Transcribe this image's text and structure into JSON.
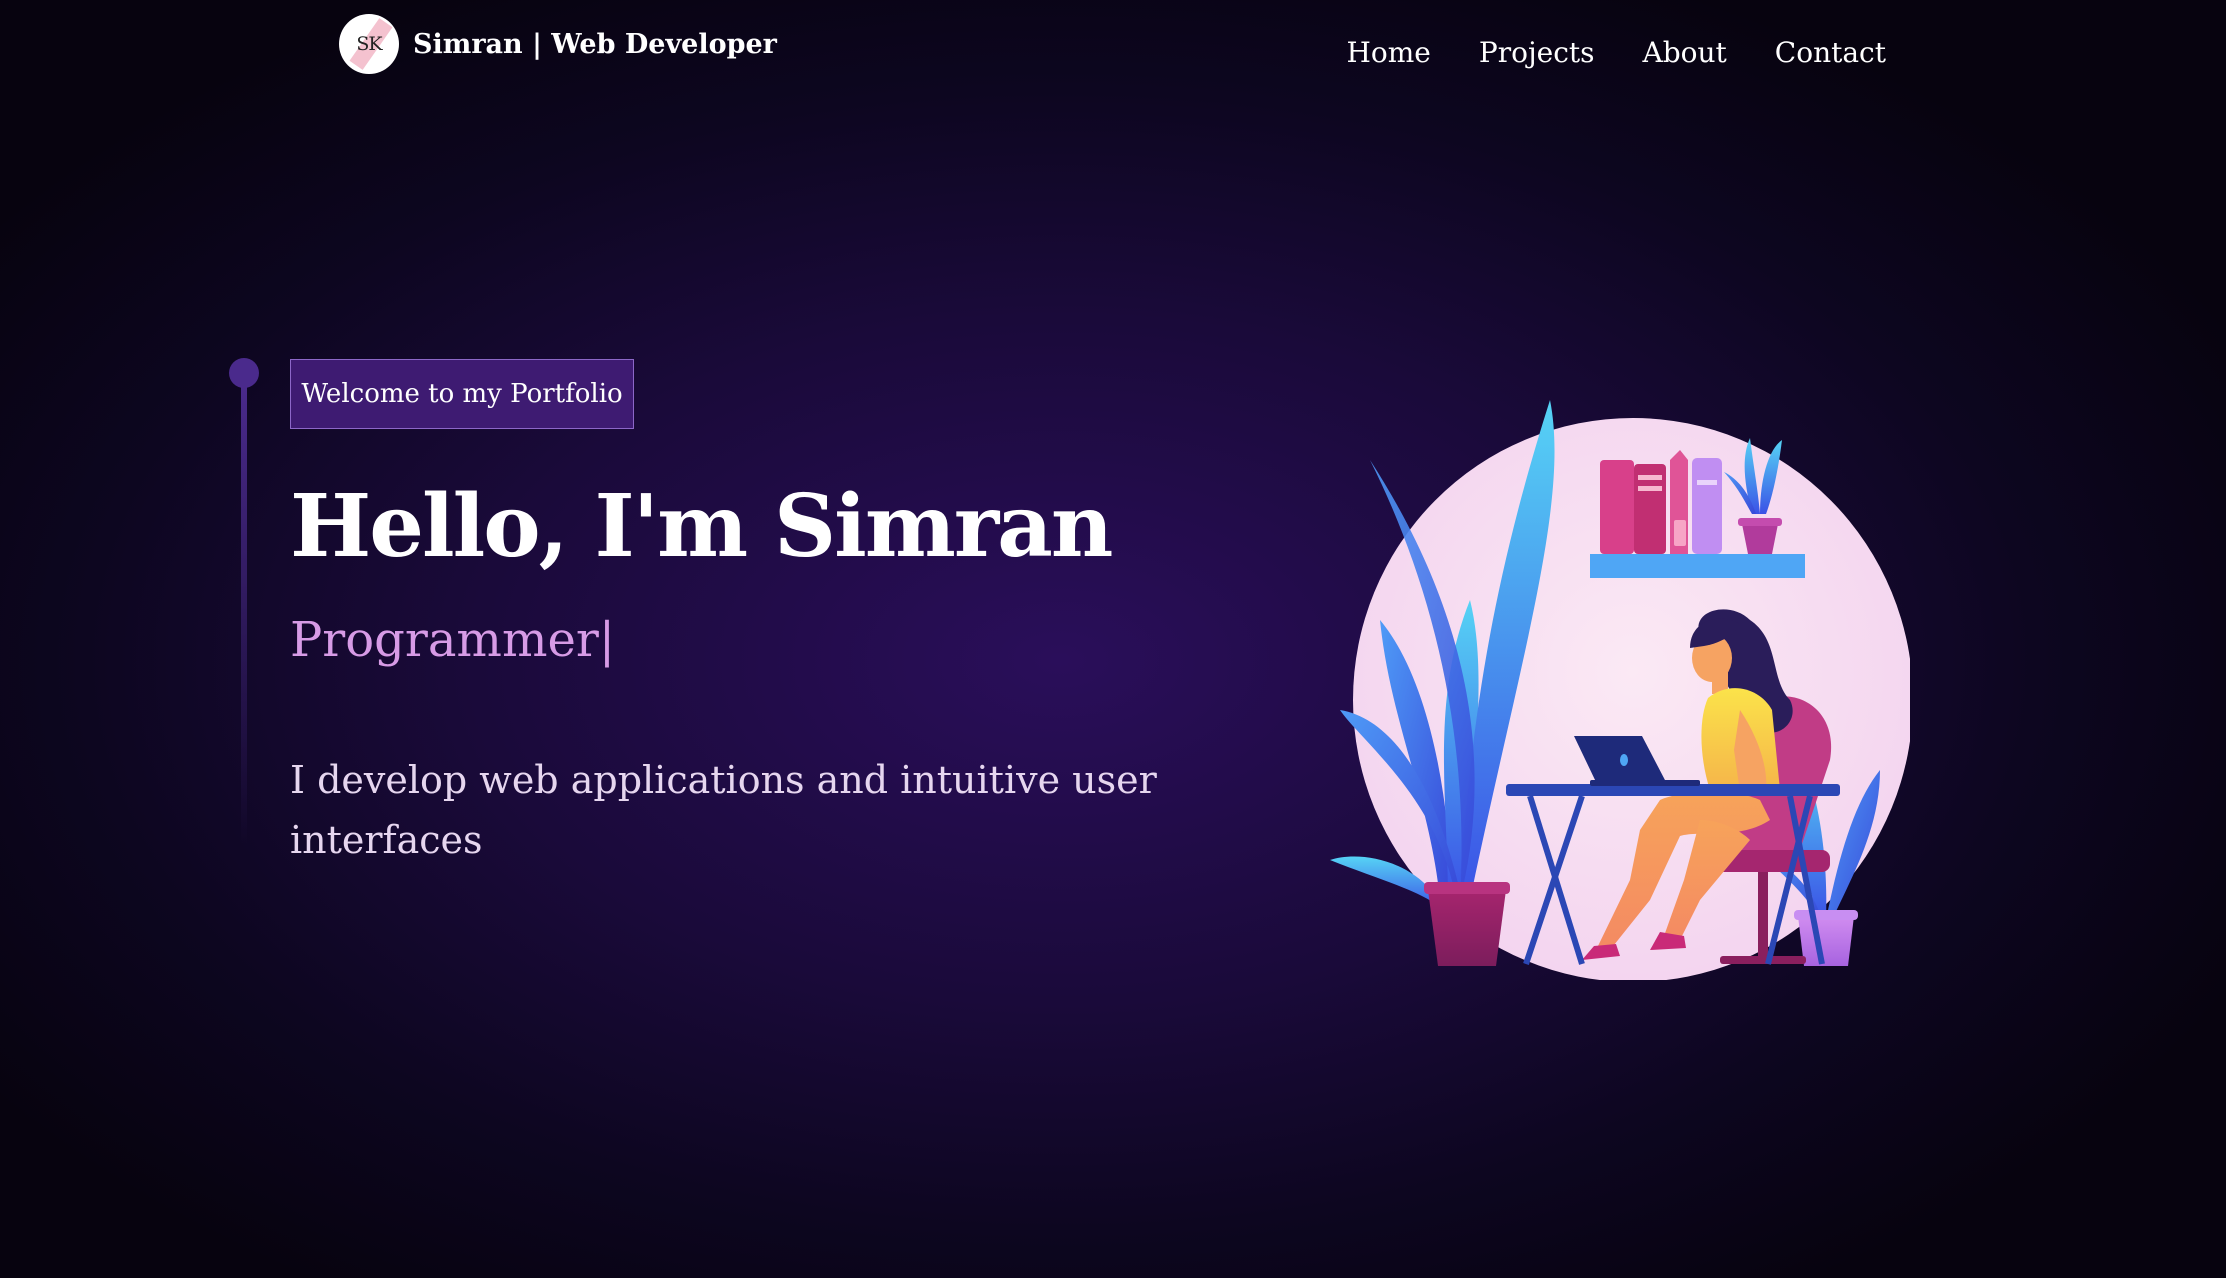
{
  "navbar": {
    "logo_initials": "SK",
    "brand": "Simran  | Web Developer",
    "links": [
      "Home",
      "Projects",
      "About",
      "Contact"
    ]
  },
  "hero": {
    "badge": "Welcome to my Portfolio",
    "title": "Hello, I'm Simran",
    "role": "Programmer",
    "caret": "|",
    "description": "I develop web applications and intuitive user interfaces"
  },
  "colors": {
    "background": "#1a0a3a",
    "badge_bg": "#3e1b72",
    "accent": "#d79be6",
    "timeline": "#4a2a8c"
  },
  "illustration": {
    "subject": "woman-working-on-laptop-illustration"
  }
}
